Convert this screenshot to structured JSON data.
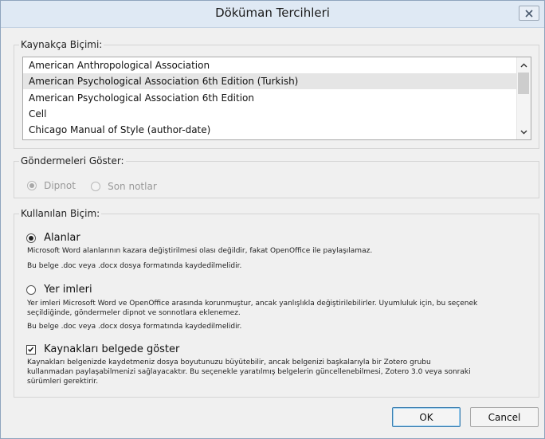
{
  "window": {
    "title": "Döküman Tercihleri"
  },
  "citation_style": {
    "legend": "Kaynakça Biçimi:",
    "items": [
      "American Anthropological Association",
      "American Psychological Association 6th Edition (Turkish)",
      "American Psychological Association 6th Edition",
      "Cell",
      "Chicago Manual of Style (author-date)"
    ],
    "selected_index": 1
  },
  "notes": {
    "legend": "Göndermeleri Göster:",
    "footnotes_label": "Dipnot",
    "endnotes_label": "Son notlar",
    "selected": "footnotes"
  },
  "format": {
    "legend": "Kullanılan Biçim:",
    "fields_label": "Alanlar",
    "fields_desc": "Microsoft Word alanlarının kazara değiştirilmesi olası değildir, fakat OpenOffice ile paylaşılamaz.",
    "fields_save": "Bu belge .doc veya .docx dosya formatında kaydedilmelidir.",
    "bookmarks_label": "Yer imleri",
    "bookmarks_desc_1": "Yer imleri Microsoft Word ve OpenOffice arasında korunmuştur, ancak yanlışlıkla değiştirilebilirler. Uyumluluk için, bu seçenek",
    "bookmarks_desc_2": "seçildiğinde, göndermeler dipnot ve sonnotlara eklenemez.",
    "bookmarks_save": "Bu belge .doc veya .docx dosya formatında kaydedilmelidir.",
    "selected": "fields",
    "store_label": "Kaynakları belgede göster",
    "store_checked": true,
    "store_desc_1": "Kaynakları belgenizde kaydetmeniz dosya boyutunuzu büyütebilir, ancak belgenizi başkalarıyla bir Zotero grubu",
    "store_desc_2": "kullanmadan paylaşabilmenizi sağlayacaktır. Bu seçenekle yaratılmış belgelerin güncellenebilmesi, Zotero 3.0 veya sonraki",
    "store_desc_3": "sürümleri gerektirir."
  },
  "buttons": {
    "ok": "OK",
    "cancel": "Cancel"
  }
}
